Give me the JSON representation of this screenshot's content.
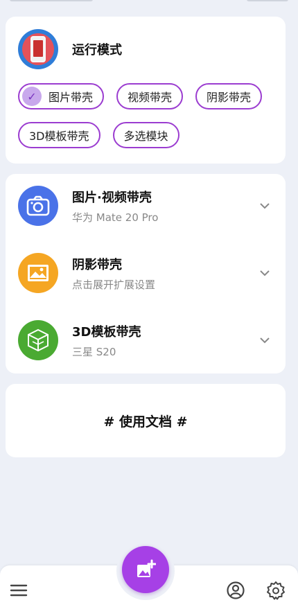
{
  "colors": {
    "accent": "#a640e6",
    "chip_border": "#9b3cd0",
    "background": "#edf0f7",
    "camera_icon_bg": "#4a72e8",
    "shadow_icon_bg": "#f5a623",
    "model_icon_bg": "#4aaa32"
  },
  "mode_card": {
    "icon": "phone-icon",
    "title": "运行模式",
    "chips": [
      {
        "label": "图片带壳",
        "selected": true
      },
      {
        "label": "视频带壳",
        "selected": false
      },
      {
        "label": "阴影带壳",
        "selected": false
      },
      {
        "label": "3D模板带壳",
        "selected": false
      },
      {
        "label": "多选模块",
        "selected": false
      }
    ]
  },
  "settings_list": [
    {
      "icon": "camera-icon",
      "title": "图片·视频带壳",
      "subtitle": "华为 Mate 20 Pro"
    },
    {
      "icon": "image-icon",
      "title": "阴影带壳",
      "subtitle": "点击展开扩展设置"
    },
    {
      "icon": "3d-cube-icon",
      "title": "3D模板带壳",
      "subtitle": "三星 S20"
    }
  ],
  "docs_card": {
    "label": "# 使用文档 #"
  },
  "bottom_nav": {
    "menu_icon": "menu-icon",
    "fab_icon": "add-image-icon",
    "profile_icon": "profile-icon",
    "settings_icon": "gear-icon"
  }
}
